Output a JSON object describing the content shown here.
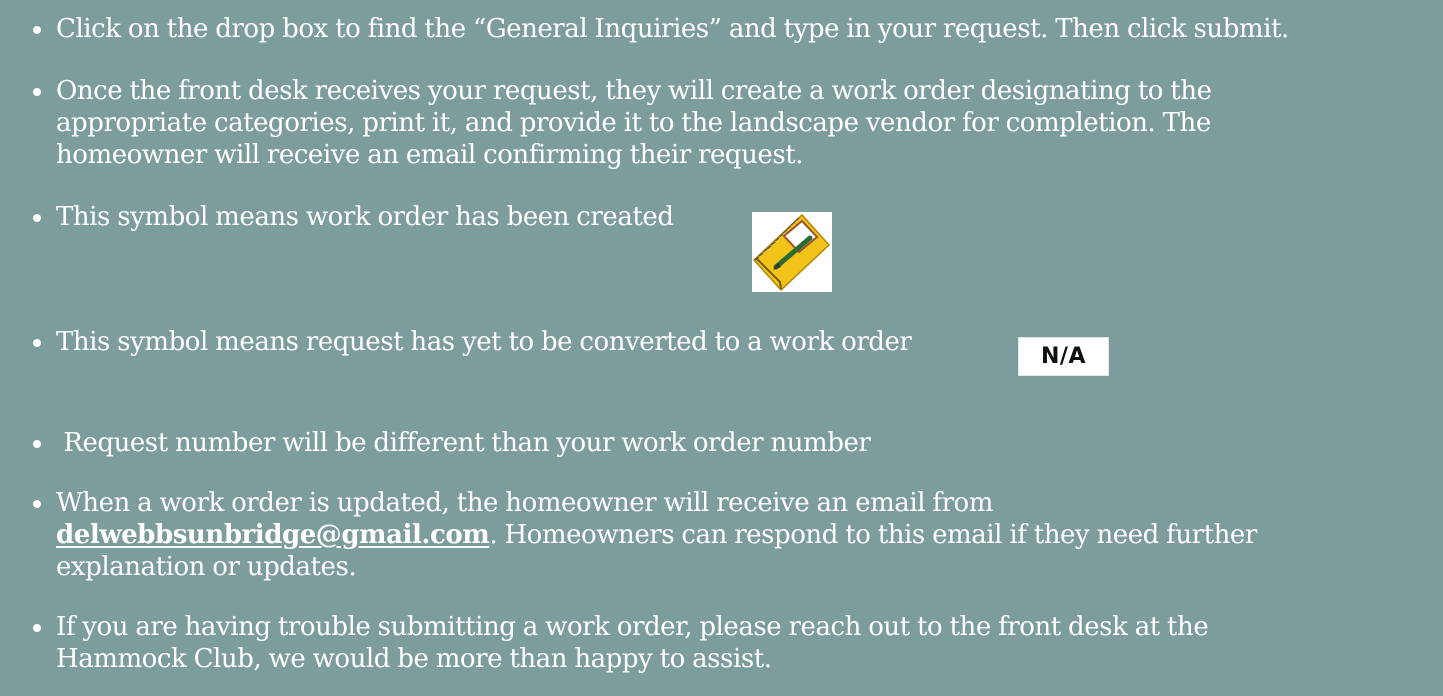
{
  "bullets": [
    {
      "lines": [
        "Click on the drop box to find the “General Inquiries” and type in your request.  Then click submit."
      ]
    },
    {
      "lines": [
        "Once the front desk receives your request, they will create a work order designating to the",
        "appropriate categories, print it, and provide it to the landscape vendor for completion. The",
        "homeowner will receive an email confirming their request."
      ]
    },
    {
      "lines": [
        "This symbol means work order has been created"
      ],
      "icon": "notebook-pencil-icon"
    },
    {
      "lines": [
        "This symbol means request has yet to be converted to a work order"
      ],
      "icon": "na-badge-icon",
      "icon_text": "N/A"
    },
    {
      "lines": [
        " Request number will be different than your work order number"
      ]
    },
    {
      "lines": [
        "When a work order is updated, the homeowner will receive an email from",
        ". Homeowners can respond to this email if they need further",
        "explanation or updates."
      ],
      "email": "delwebbsunbridge@gmail.com"
    },
    {
      "lines": [
        "If you are having trouble submitting a work order, please reach out to the front desk at the",
        "Hammock Club, we would be more than happy to assist."
      ]
    }
  ],
  "colors": {
    "background": "#7d9c9c",
    "text": "#ffffff",
    "notebook": "#f2c318"
  }
}
